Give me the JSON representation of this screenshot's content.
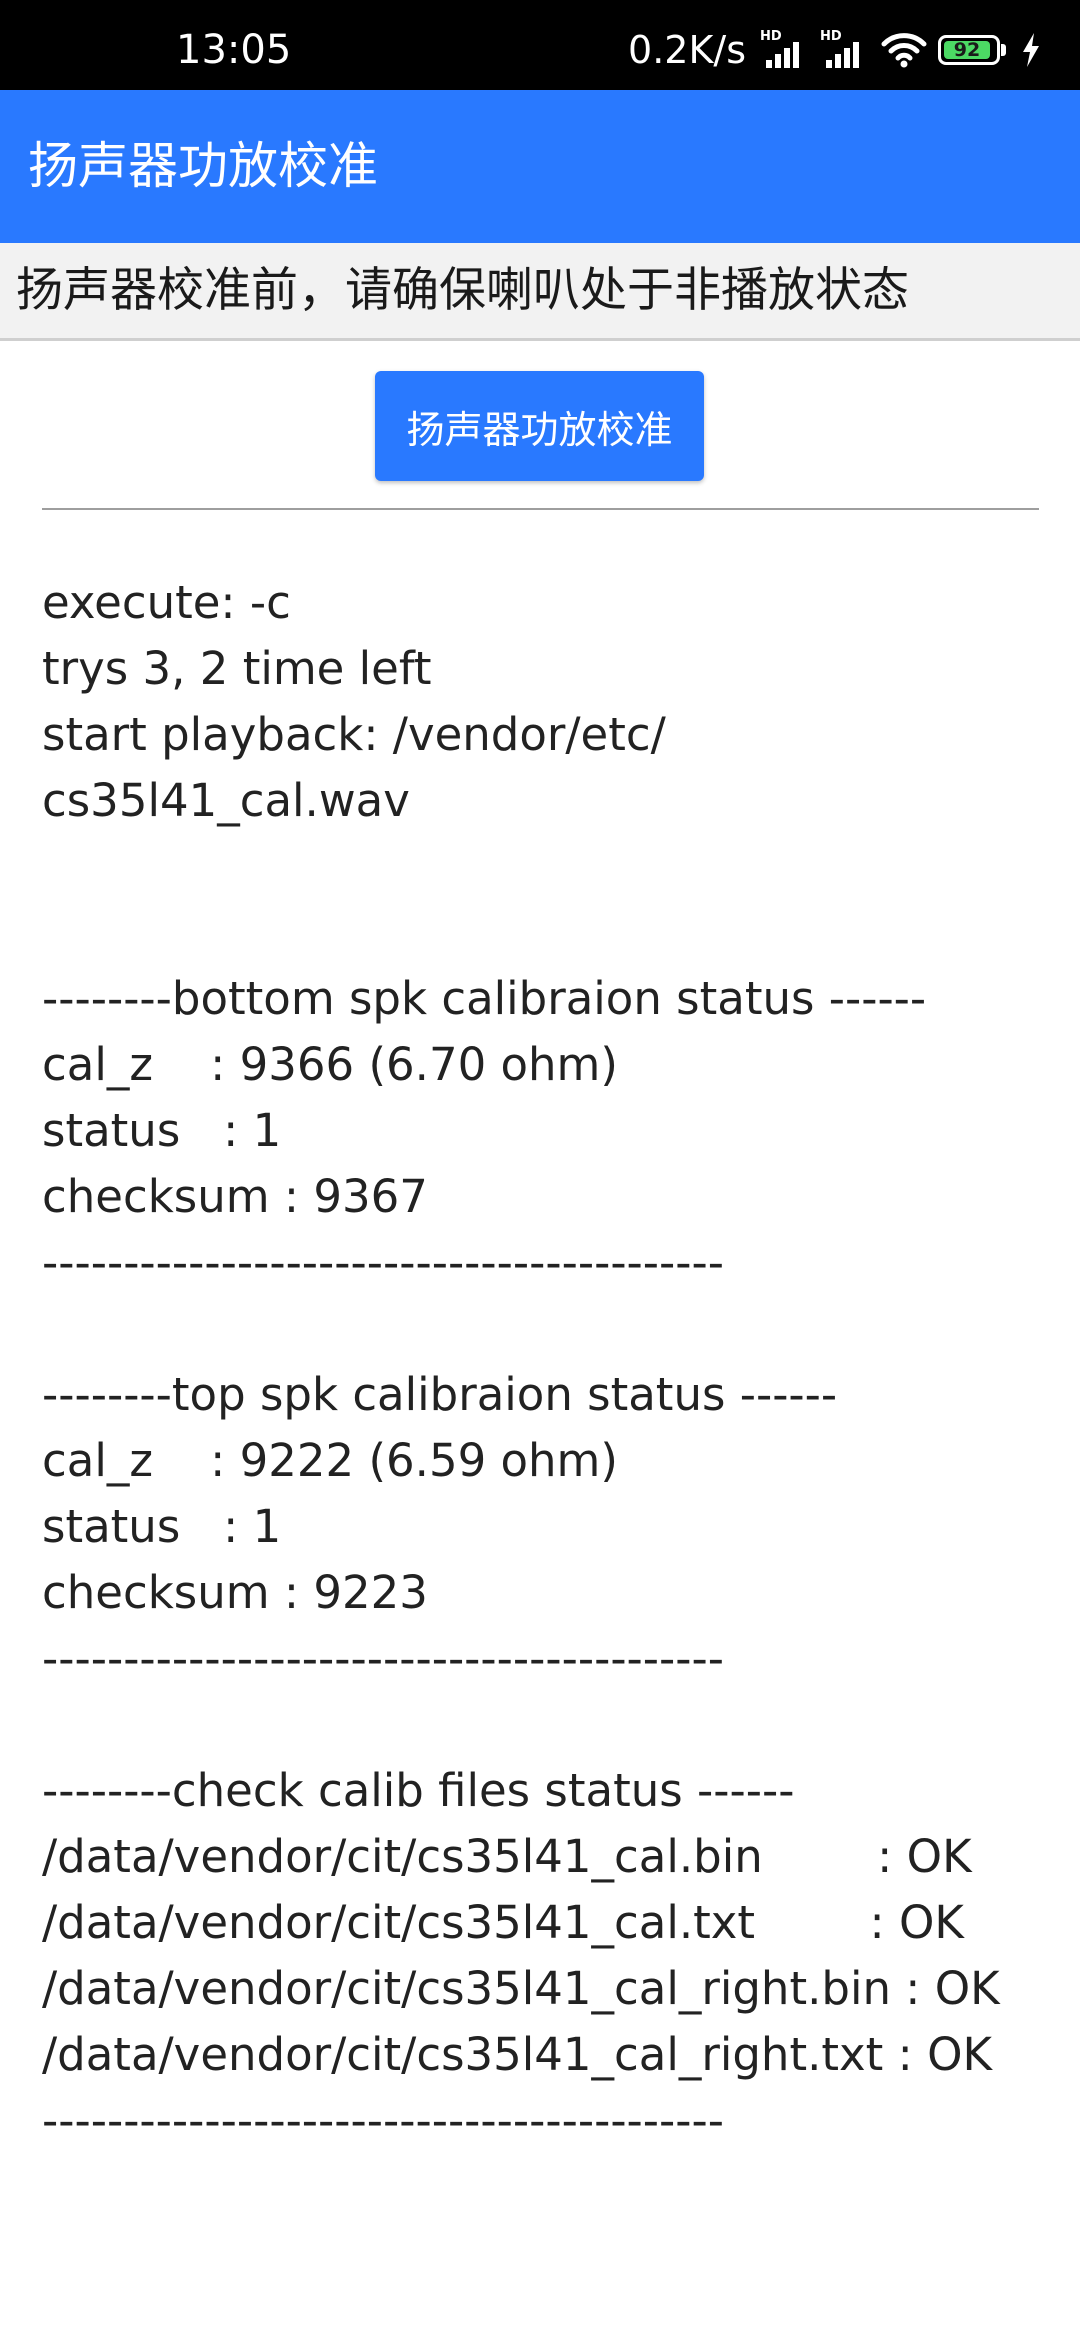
{
  "status_bar": {
    "time": "13:05",
    "net_speed": "0.2K/s",
    "signal_1_label": "HD",
    "signal_2_label": "HD",
    "battery_level": "92",
    "battery_color": "#4cd964"
  },
  "app_bar": {
    "title": "扬声器功放校准",
    "color": "#2979ff"
  },
  "notice": {
    "text": "扬声器校准前，请确保喇叭处于非播放状态"
  },
  "calibrate_button": {
    "label": "扬声器功放校准"
  },
  "log": {
    "lines": [
      "execute: -c",
      "trys 3, 2 time left",
      "start playback: /vendor/etc/",
      "cs35l41_cal.wav",
      "",
      "",
      "--------bottom spk calibraion status ------",
      "cal_z    : 9366 (6.70 ohm)",
      "status   : 1",
      "checksum : 9367",
      "------------------------------------------",
      "",
      "--------top spk calibraion status ------",
      "cal_z    : 9222 (6.59 ohm)",
      "status   : 1",
      "checksum : 9223",
      "------------------------------------------",
      "",
      "--------check calib files status ------",
      "/data/vendor/cit/cs35l41_cal.bin        : OK",
      "/data/vendor/cit/cs35l41_cal.txt        : OK",
      "/data/vendor/cit/cs35l41_cal_right.bin : OK",
      "/data/vendor/cit/cs35l41_cal_right.txt : OK",
      "------------------------------------------"
    ]
  }
}
